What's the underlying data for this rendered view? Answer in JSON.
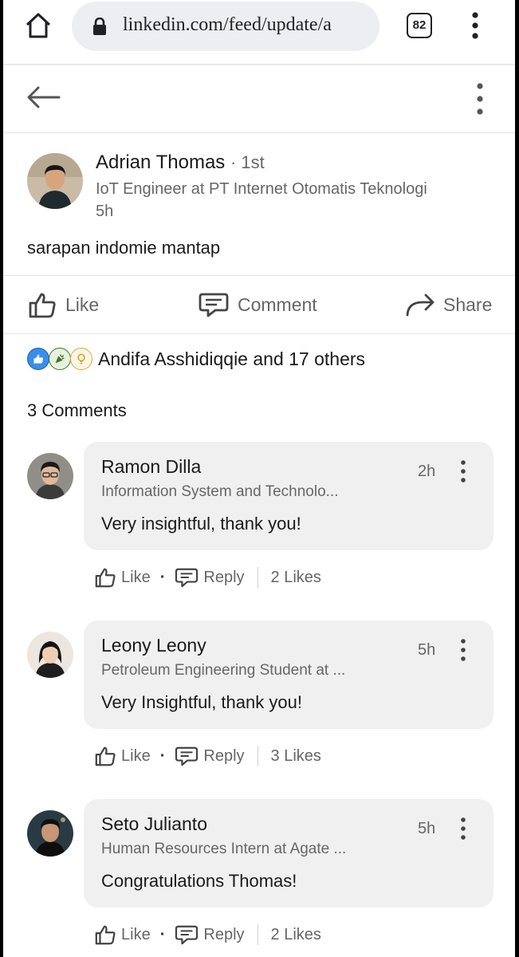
{
  "browser": {
    "url": "linkedin.com/feed/update/a",
    "tab_count": "82"
  },
  "post": {
    "author_name": "Adrian Thomas",
    "author_degree": "· 1st",
    "author_headline": "IoT Engineer at PT Internet Otomatis Teknologi",
    "time": "5h",
    "body": "sarapan indomie mantap",
    "actions": {
      "like_label": "Like",
      "comment_label": "Comment",
      "share_label": "Share"
    },
    "reactions": {
      "icons": [
        "like-icon",
        "celebrate-icon",
        "insightful-icon"
      ],
      "reactor_name": "Andifa Asshidiqqie",
      "connector": "and",
      "others": "17 others"
    },
    "comments_count_label": "3 Comments"
  },
  "comments": [
    {
      "name": "Ramon Dilla",
      "headline": "Information System and Technolo...",
      "text": "Very insightful, thank you!",
      "time": "2h",
      "like_label": "Like",
      "reply_label": "Reply",
      "likes": "2 Likes"
    },
    {
      "name": "Leony Leony",
      "headline": "Petroleum Engineering Student at ...",
      "text": "Very Insightful, thank you!",
      "time": "5h",
      "like_label": "Like",
      "reply_label": "Reply",
      "likes": "3 Likes"
    },
    {
      "name": "Seto Julianto",
      "headline": "Human Resources Intern at Agate ...",
      "text": "Congratulations Thomas!",
      "time": "5h",
      "like_label": "Like",
      "reply_label": "Reply",
      "likes": "2 Likes"
    }
  ],
  "colors": {
    "primary_text": "#1a1a1a",
    "secondary_text": "#666666",
    "comment_bubble": "#f0f0f0",
    "like_blue": "#378fe9",
    "celebrate_green": "#44712e",
    "insightful_yellow": "#f5bb5c"
  }
}
